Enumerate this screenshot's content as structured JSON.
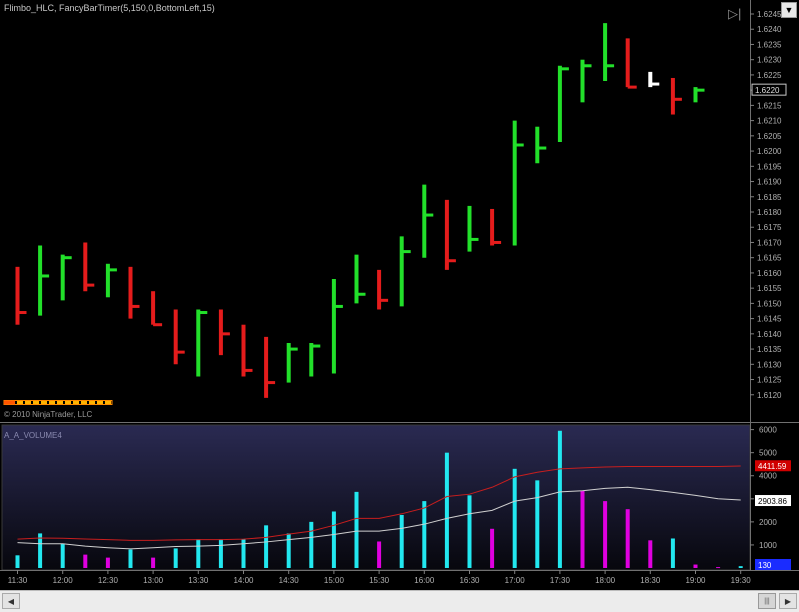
{
  "header": {
    "title": "Flimbo_HLC, FancyBarTimer(5,150,0,BottomLeft,15)"
  },
  "copyright": "© 2010 NinjaTrader, LLC",
  "colors": {
    "up": "#22e02a",
    "down": "#e51c1c",
    "current": "#ffffff",
    "volume_up": "#22e8f0",
    "volume_down": "#e000e0",
    "ma_fast": "#d0d0d0",
    "ma_slow": "#c81e1e"
  },
  "icons": {
    "corner": "dropdown-arrow-icon",
    "play": "play-to-end-icon"
  },
  "chart_data": [
    {
      "type": "ohlc",
      "style": "HLC bars",
      "ylim": [
        1.6115,
        1.6245
      ],
      "yticks": [
        "1.6120",
        "1.6125",
        "1.6130",
        "1.6135",
        "1.6140",
        "1.6145",
        "1.6150",
        "1.6155",
        "1.6160",
        "1.6165",
        "1.6170",
        "1.6175",
        "1.6180",
        "1.6185",
        "1.6190",
        "1.6195",
        "1.6200",
        "1.6205",
        "1.6210",
        "1.6215",
        "1.6220",
        "1.6225",
        "1.6230",
        "1.6235",
        "1.6240",
        "1.6245"
      ],
      "last_price_label": "1.6220",
      "bars": [
        {
          "h": 1.6162,
          "l": 1.6143,
          "c": 1.6147,
          "d": "down"
        },
        {
          "h": 1.6169,
          "l": 1.6146,
          "c": 1.6159,
          "d": "up"
        },
        {
          "h": 1.6166,
          "l": 1.6151,
          "c": 1.6165,
          "d": "up"
        },
        {
          "h": 1.617,
          "l": 1.6154,
          "c": 1.6156,
          "d": "down"
        },
        {
          "h": 1.6163,
          "l": 1.6152,
          "c": 1.6161,
          "d": "up"
        },
        {
          "h": 1.6162,
          "l": 1.6145,
          "c": 1.6149,
          "d": "down"
        },
        {
          "h": 1.6154,
          "l": 1.6143,
          "c": 1.6143,
          "d": "down"
        },
        {
          "h": 1.6148,
          "l": 1.613,
          "c": 1.6134,
          "d": "down"
        },
        {
          "h": 1.6148,
          "l": 1.6126,
          "c": 1.6147,
          "d": "up"
        },
        {
          "h": 1.6148,
          "l": 1.6133,
          "c": 1.614,
          "d": "down"
        },
        {
          "h": 1.6143,
          "l": 1.6126,
          "c": 1.6128,
          "d": "down"
        },
        {
          "h": 1.6139,
          "l": 1.6119,
          "c": 1.6124,
          "d": "down"
        },
        {
          "h": 1.6137,
          "l": 1.6124,
          "c": 1.6135,
          "d": "up"
        },
        {
          "h": 1.6137,
          "l": 1.6126,
          "c": 1.6136,
          "d": "up"
        },
        {
          "h": 1.6158,
          "l": 1.6127,
          "c": 1.6149,
          "d": "up"
        },
        {
          "h": 1.6166,
          "l": 1.615,
          "c": 1.6153,
          "d": "up"
        },
        {
          "h": 1.6161,
          "l": 1.6148,
          "c": 1.6151,
          "d": "down"
        },
        {
          "h": 1.6172,
          "l": 1.6149,
          "c": 1.6167,
          "d": "up"
        },
        {
          "h": 1.6189,
          "l": 1.6165,
          "c": 1.6179,
          "d": "up"
        },
        {
          "h": 1.6184,
          "l": 1.6161,
          "c": 1.6164,
          "d": "down"
        },
        {
          "h": 1.6182,
          "l": 1.6167,
          "c": 1.6171,
          "d": "up"
        },
        {
          "h": 1.6181,
          "l": 1.6169,
          "c": 1.617,
          "d": "down"
        },
        {
          "h": 1.621,
          "l": 1.6169,
          "c": 1.6202,
          "d": "up"
        },
        {
          "h": 1.6208,
          "l": 1.6196,
          "c": 1.6201,
          "d": "up"
        },
        {
          "h": 1.6228,
          "l": 1.6203,
          "c": 1.6227,
          "d": "up"
        },
        {
          "h": 1.623,
          "l": 1.6216,
          "c": 1.6228,
          "d": "up"
        },
        {
          "h": 1.6242,
          "l": 1.6223,
          "c": 1.6228,
          "d": "up"
        },
        {
          "h": 1.6237,
          "l": 1.6221,
          "c": 1.6221,
          "d": "down"
        },
        {
          "h": 1.6226,
          "l": 1.6221,
          "c": 1.6222,
          "d": "current"
        },
        {
          "h": 1.6224,
          "l": 1.6212,
          "c": 1.6217,
          "d": "down"
        },
        {
          "h": 1.6221,
          "l": 1.6216,
          "c": 1.622,
          "d": "up"
        }
      ]
    },
    {
      "type": "bar",
      "title": "A_A_VOLUME4",
      "ylim": [
        0,
        6200
      ],
      "yticks": [
        "1000",
        "2000",
        "3000",
        "4000",
        "5000",
        "6000"
      ],
      "xticks": [
        "11:30",
        "12:00",
        "12:30",
        "13:00",
        "13:30",
        "14:00",
        "14:30",
        "15:00",
        "15:30",
        "16:00",
        "16:30",
        "17:00",
        "17:30",
        "18:00",
        "18:30",
        "19:00",
        "19:30"
      ],
      "values": [
        550,
        1500,
        1050,
        580,
        450,
        800,
        450,
        850,
        1250,
        1250,
        1250,
        1850,
        1500,
        2000,
        2450,
        3300,
        1150,
        2300,
        2900,
        5000,
        3150,
        1700,
        4300,
        3800,
        5950,
        3350,
        2900,
        2550,
        1200,
        1280,
        150,
        40,
        80
      ],
      "directions": [
        "up",
        "up",
        "up",
        "down",
        "down",
        "up",
        "down",
        "up",
        "up",
        "up",
        "up",
        "up",
        "up",
        "up",
        "up",
        "up",
        "down",
        "up",
        "up",
        "up",
        "up",
        "down",
        "up",
        "up",
        "up",
        "down",
        "down",
        "down",
        "down",
        "up",
        "down",
        "down",
        "up"
      ],
      "series": [
        {
          "name": "",
          "values": [
            1250,
            1300,
            1290,
            1260,
            1230,
            1200,
            1200,
            1220,
            1230,
            1230,
            1250,
            1330,
            1470,
            1600,
            1850,
            2150,
            2150,
            2350,
            2600,
            3100,
            3200,
            3500,
            3950,
            4150,
            4300,
            4340,
            4380,
            4400,
            4400,
            4400,
            4400,
            4400,
            4420
          ]
        },
        {
          "name": "",
          "values": [
            1100,
            1050,
            1050,
            950,
            880,
            830,
            880,
            930,
            950,
            980,
            1050,
            1130,
            1230,
            1330,
            1450,
            1600,
            1600,
            1720,
            1900,
            2150,
            2350,
            2500,
            2900,
            3050,
            3300,
            3350,
            3450,
            3500,
            3400,
            3280,
            3150,
            3000,
            2950
          ]
        }
      ],
      "value_labels": [
        "4411.59",
        "2903.86",
        "130"
      ]
    }
  ],
  "scrollbar": {
    "left_arrow": "◀",
    "right_arrow": "▶",
    "thumb": "|||"
  }
}
